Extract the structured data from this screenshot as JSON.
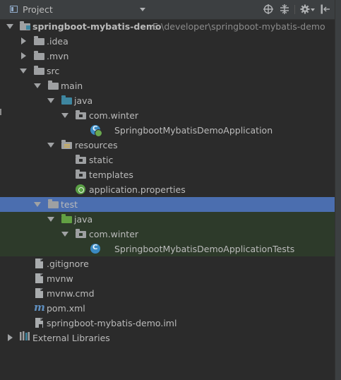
{
  "header": {
    "title": "Project",
    "icons": [
      "project-icon",
      "dropdown-arrow-icon",
      "target-icon",
      "collapse-all-icon",
      "settings-gear-icon",
      "hide-panel-icon"
    ]
  },
  "colors": {
    "background": "#2b2b2b",
    "toolbar": "#3c3f41",
    "selection": "#4b6eaf",
    "test_folder_bg": "#2d3a2a",
    "source_folder": "#3e86a0",
    "test_folder": "#62a043"
  },
  "tree": [
    {
      "label": "springboot-mybatis-demo",
      "path": "E:\\developer\\springboot-mybatis-demo",
      "icon": "module-folder-icon",
      "expanded": true
    },
    {
      "label": ".idea",
      "icon": "folder-icon",
      "expanded": false
    },
    {
      "label": ".mvn",
      "icon": "folder-icon",
      "expanded": false
    },
    {
      "label": "src",
      "icon": "folder-icon",
      "expanded": true
    },
    {
      "label": "main",
      "icon": "folder-icon",
      "expanded": true
    },
    {
      "label": "java",
      "icon": "source-folder-icon",
      "expanded": true
    },
    {
      "label": "com.winter",
      "icon": "package-icon",
      "expanded": true
    },
    {
      "label": "SpringbootMybatisDemoApplication",
      "icon": "spring-boot-class-icon"
    },
    {
      "label": "resources",
      "icon": "resources-folder-icon",
      "expanded": true
    },
    {
      "label": "static",
      "icon": "package-icon"
    },
    {
      "label": "templates",
      "icon": "package-icon"
    },
    {
      "label": "application.properties",
      "icon": "spring-properties-icon"
    },
    {
      "label": "test",
      "icon": "folder-icon",
      "expanded": true,
      "selected": true
    },
    {
      "label": "java",
      "icon": "test-source-folder-icon",
      "expanded": true
    },
    {
      "label": "com.winter",
      "icon": "package-icon",
      "expanded": true
    },
    {
      "label": "SpringbootMybatisDemoApplicationTests",
      "icon": "test-class-icon"
    },
    {
      "label": ".gitignore",
      "icon": "text-file-icon"
    },
    {
      "label": "mvnw",
      "icon": "text-file-icon"
    },
    {
      "label": "mvnw.cmd",
      "icon": "text-file-icon"
    },
    {
      "label": "pom.xml",
      "icon": "maven-pom-icon"
    },
    {
      "label": "springboot-mybatis-demo.iml",
      "icon": "module-file-icon"
    },
    {
      "label": "External Libraries",
      "icon": "external-libraries-icon",
      "expanded": false
    }
  ]
}
